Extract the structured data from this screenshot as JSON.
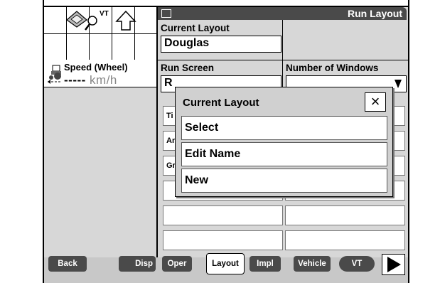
{
  "run_layout": {
    "title": "Run Layout",
    "current_layout_label": "Current Layout",
    "current_layout_value": "Douglas",
    "run_screen_label": "Run Screen",
    "run_screen_value_partial": "R",
    "num_windows_label": "Number of Windows",
    "window_cells": [
      "Ti",
      "Ar",
      "Gr",
      "",
      "",
      "",
      "",
      "",
      "",
      "",
      "",
      ""
    ]
  },
  "speed": {
    "label": "Speed (Wheel)",
    "value": "-----",
    "unit": "km/h"
  },
  "dialog": {
    "title": "Current Layout",
    "close": "×",
    "options": [
      "Select",
      "Edit Name",
      "New"
    ]
  },
  "bottom": {
    "back": "Back",
    "disp": "Disp",
    "oper": "Oper",
    "layout": "Layout",
    "impl": "Impl",
    "vehicle": "Vehicle",
    "vt": "VT"
  },
  "top_icons": {
    "vt": "VT",
    "book": "book-icon",
    "search": "magnifier-icon",
    "up": "up-arrow-icon"
  }
}
